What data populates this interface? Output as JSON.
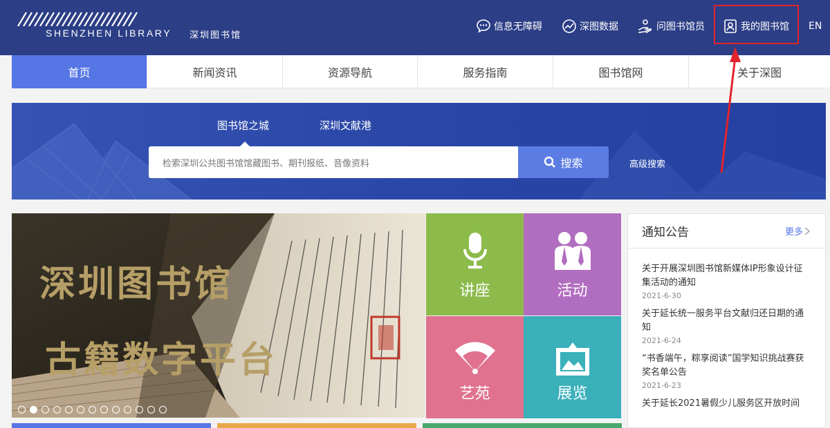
{
  "header": {
    "logo_en": "SHENZHEN LIBRARY",
    "logo_cn": "深圳图书馆",
    "links": [
      {
        "label": "信息无障碍",
        "icon": "chat-bubble-icon"
      },
      {
        "label": "深图数据",
        "icon": "chart-line-icon"
      },
      {
        "label": "问图书馆员",
        "icon": "hand-helper-icon"
      },
      {
        "label": "我的图书馆",
        "icon": "user-card-icon"
      }
    ],
    "lang": "EN"
  },
  "nav": {
    "tabs": [
      "首页",
      "新闻资讯",
      "资源导航",
      "服务指南",
      "图书馆网",
      "关于深图"
    ],
    "active_index": 0
  },
  "search": {
    "tabs": [
      "图书馆之城",
      "深圳文献港"
    ],
    "placeholder": "检索深圳公共图书馆馆藏图书、期刊报纸、音像资料",
    "button": "搜索",
    "advanced": "高级搜索"
  },
  "hero": {
    "line1": "深圳图书馆",
    "line2": "古籍数字平台",
    "dots_total": 13,
    "active_dot": 1
  },
  "tiles": [
    {
      "label": "讲座",
      "icon": "microphone-icon",
      "color": "#8cbb4b"
    },
    {
      "label": "活动",
      "icon": "people-icon",
      "color": "#b16dbf"
    },
    {
      "label": "艺苑",
      "icon": "fan-icon",
      "color": "#e0718f"
    },
    {
      "label": "展览",
      "icon": "picture-frame-icon",
      "color": "#3ab0ba"
    }
  ],
  "notices": {
    "title": "通知公告",
    "more": "更多",
    "items": [
      {
        "text": "关于开展深圳图书馆新媒体IP形象设计征集活动的通知",
        "date": "2021-6-30"
      },
      {
        "text": "关于延长统一服务平台文献归还日期的通知",
        "date": "2021-6-24"
      },
      {
        "text": "“书香端午，粽享阅读”国学知识挑战赛获奖名单公告",
        "date": "2021-6-23"
      },
      {
        "text": "关于延长2021暑假少儿服务区开放时间",
        "date": ""
      }
    ]
  },
  "colors": {
    "header_bg": "#2c3e86",
    "nav_active": "#5576e4",
    "search_bg": "#2b47a8",
    "search_button": "#5b7ce3",
    "highlight": "#e3232b"
  }
}
